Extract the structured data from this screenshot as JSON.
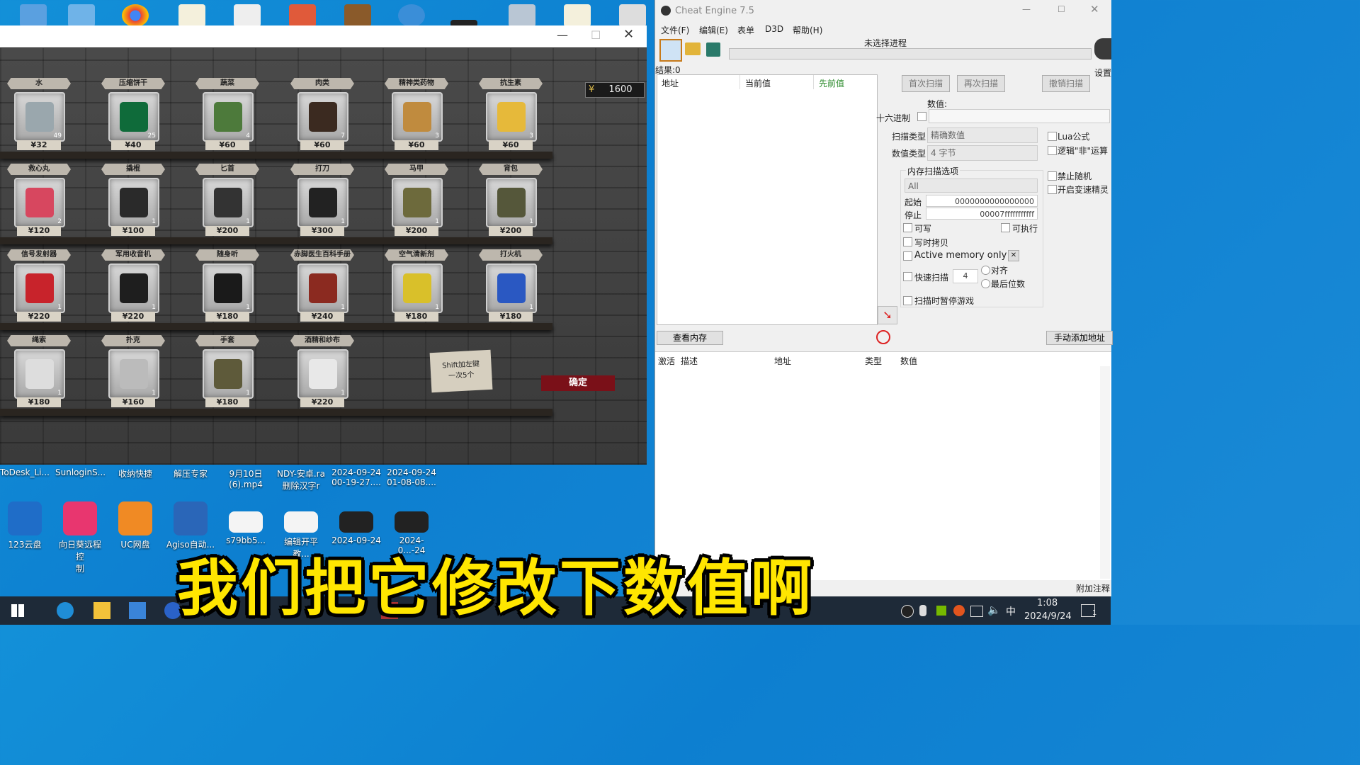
{
  "desktop": {
    "labels_row1": [
      "ToDesk_Li...",
      "SunloginS...",
      "收纳快捷",
      "解压专家",
      "9月10日\n(6).mp4",
      "NDY-安卓.ra\n删除汉字r",
      "2024-09-24\n00-19-27....",
      "2024-09-24\n01-08-08...."
    ],
    "labels_row2": [
      "123云盘",
      "向日葵远程控\n制",
      "UC网盘",
      "Agiso自动...",
      "s79bb5...",
      "编辑开平教...",
      "2024-09-24",
      "2024-0...-24"
    ]
  },
  "game": {
    "balance": "1600",
    "confirm": "确定",
    "tip": "Shift加左键\n一次5个",
    "rows": [
      [
        {
          "name": "水",
          "price": "¥32",
          "count": "49",
          "color": "#9aa7ad"
        },
        {
          "name": "压缩饼干",
          "price": "¥40",
          "count": "25",
          "color": "#0f6b3a"
        },
        {
          "name": "蔬菜",
          "price": "¥60",
          "count": "4",
          "color": "#4d7a3b"
        },
        {
          "name": "肉类",
          "price": "¥60",
          "count": "7",
          "color": "#3b2a20"
        },
        {
          "name": "精神类药物",
          "price": "¥60",
          "count": "3",
          "color": "#c08b3e"
        },
        {
          "name": "抗生素",
          "price": "¥60",
          "count": "3",
          "color": "#e6b93a"
        }
      ],
      [
        {
          "name": "救心丸",
          "price": "¥120",
          "count": "2",
          "color": "#d7475f"
        },
        {
          "name": "撬棍",
          "price": "¥100",
          "count": "1",
          "color": "#2a2a2a"
        },
        {
          "name": "匕首",
          "price": "¥200",
          "count": "1",
          "color": "#333"
        },
        {
          "name": "打刀",
          "price": "¥300",
          "count": "1",
          "color": "#222"
        },
        {
          "name": "马甲",
          "price": "¥200",
          "count": "1",
          "color": "#6d6a3c"
        },
        {
          "name": "背包",
          "price": "¥200",
          "count": "1",
          "color": "#55573a"
        }
      ],
      [
        {
          "name": "信号发射器",
          "price": "¥220",
          "count": "1",
          "color": "#c8232b"
        },
        {
          "name": "军用收音机",
          "price": "¥220",
          "count": "1",
          "color": "#1e1e1e"
        },
        {
          "name": "随身听",
          "price": "¥180",
          "count": "1",
          "color": "#1a1a1a"
        },
        {
          "name": "赤脚医生百科手册",
          "price": "¥240",
          "count": "1",
          "color": "#8b2a20"
        },
        {
          "name": "空气清新剂",
          "price": "¥180",
          "count": "1",
          "color": "#d9c02a"
        },
        {
          "name": "打火机",
          "price": "¥180",
          "count": "1",
          "color": "#2a58c2"
        }
      ],
      [
        {
          "name": "绳索",
          "price": "¥180",
          "count": "1",
          "color": "#ddd"
        },
        {
          "name": "扑克",
          "price": "¥160",
          "count": "1",
          "color": "#bbb"
        },
        {
          "name": "手套",
          "price": "¥180",
          "count": "1",
          "color": "#5e5a3a"
        },
        {
          "name": "酒精和纱布",
          "price": "¥220",
          "count": "1",
          "color": "#e8e8e8"
        }
      ]
    ]
  },
  "ce": {
    "title": "Cheat Engine 7.5",
    "menu": [
      "文件(F)",
      "编辑(E)",
      "表单",
      "D3D",
      "帮助(H)"
    ],
    "process": "未选择进程",
    "results": "结果:0",
    "settings": "设置",
    "cols_top": [
      "地址",
      "当前值",
      "先前值"
    ],
    "first_scan": "首次扫描",
    "next_scan": "再次扫描",
    "undo_scan": "撤销扫描",
    "value_label": "数值:",
    "hex_label": "十六进制",
    "scan_type_label": "扫描类型",
    "scan_type": "精确数值",
    "value_type_label": "数值类型",
    "value_type": "4 字节",
    "lua": "Lua公式",
    "not_op": "逻辑\"非\"运算",
    "no_random": "禁止随机",
    "speedhack": "开启变速精灵",
    "mem_group": "内存扫描选项",
    "mem_all": "All",
    "start_label": "起始",
    "start_val": "0000000000000000",
    "stop_label": "停止",
    "stop_val": "00007fffffffffff",
    "writable": "可写",
    "executable": "可执行",
    "cow": "写时拷贝",
    "active_mem": "Active memory only",
    "fast_scan": "快速扫描",
    "fast_val": "4",
    "align": "对齐",
    "last_digits": "最后位数",
    "pause": "扫描时暂停游戏",
    "view_mem": "查看内存",
    "add_addr": "手动添加地址",
    "cols_bottom": [
      "激活",
      "描述",
      "地址",
      "类型",
      "数值"
    ],
    "footer": "附加注释"
  },
  "taskbar": {
    "time": "1:08",
    "date": "2024/9/24",
    "ime": "中",
    "notif": "1"
  },
  "subtitle": "我们把它修改下数值啊"
}
